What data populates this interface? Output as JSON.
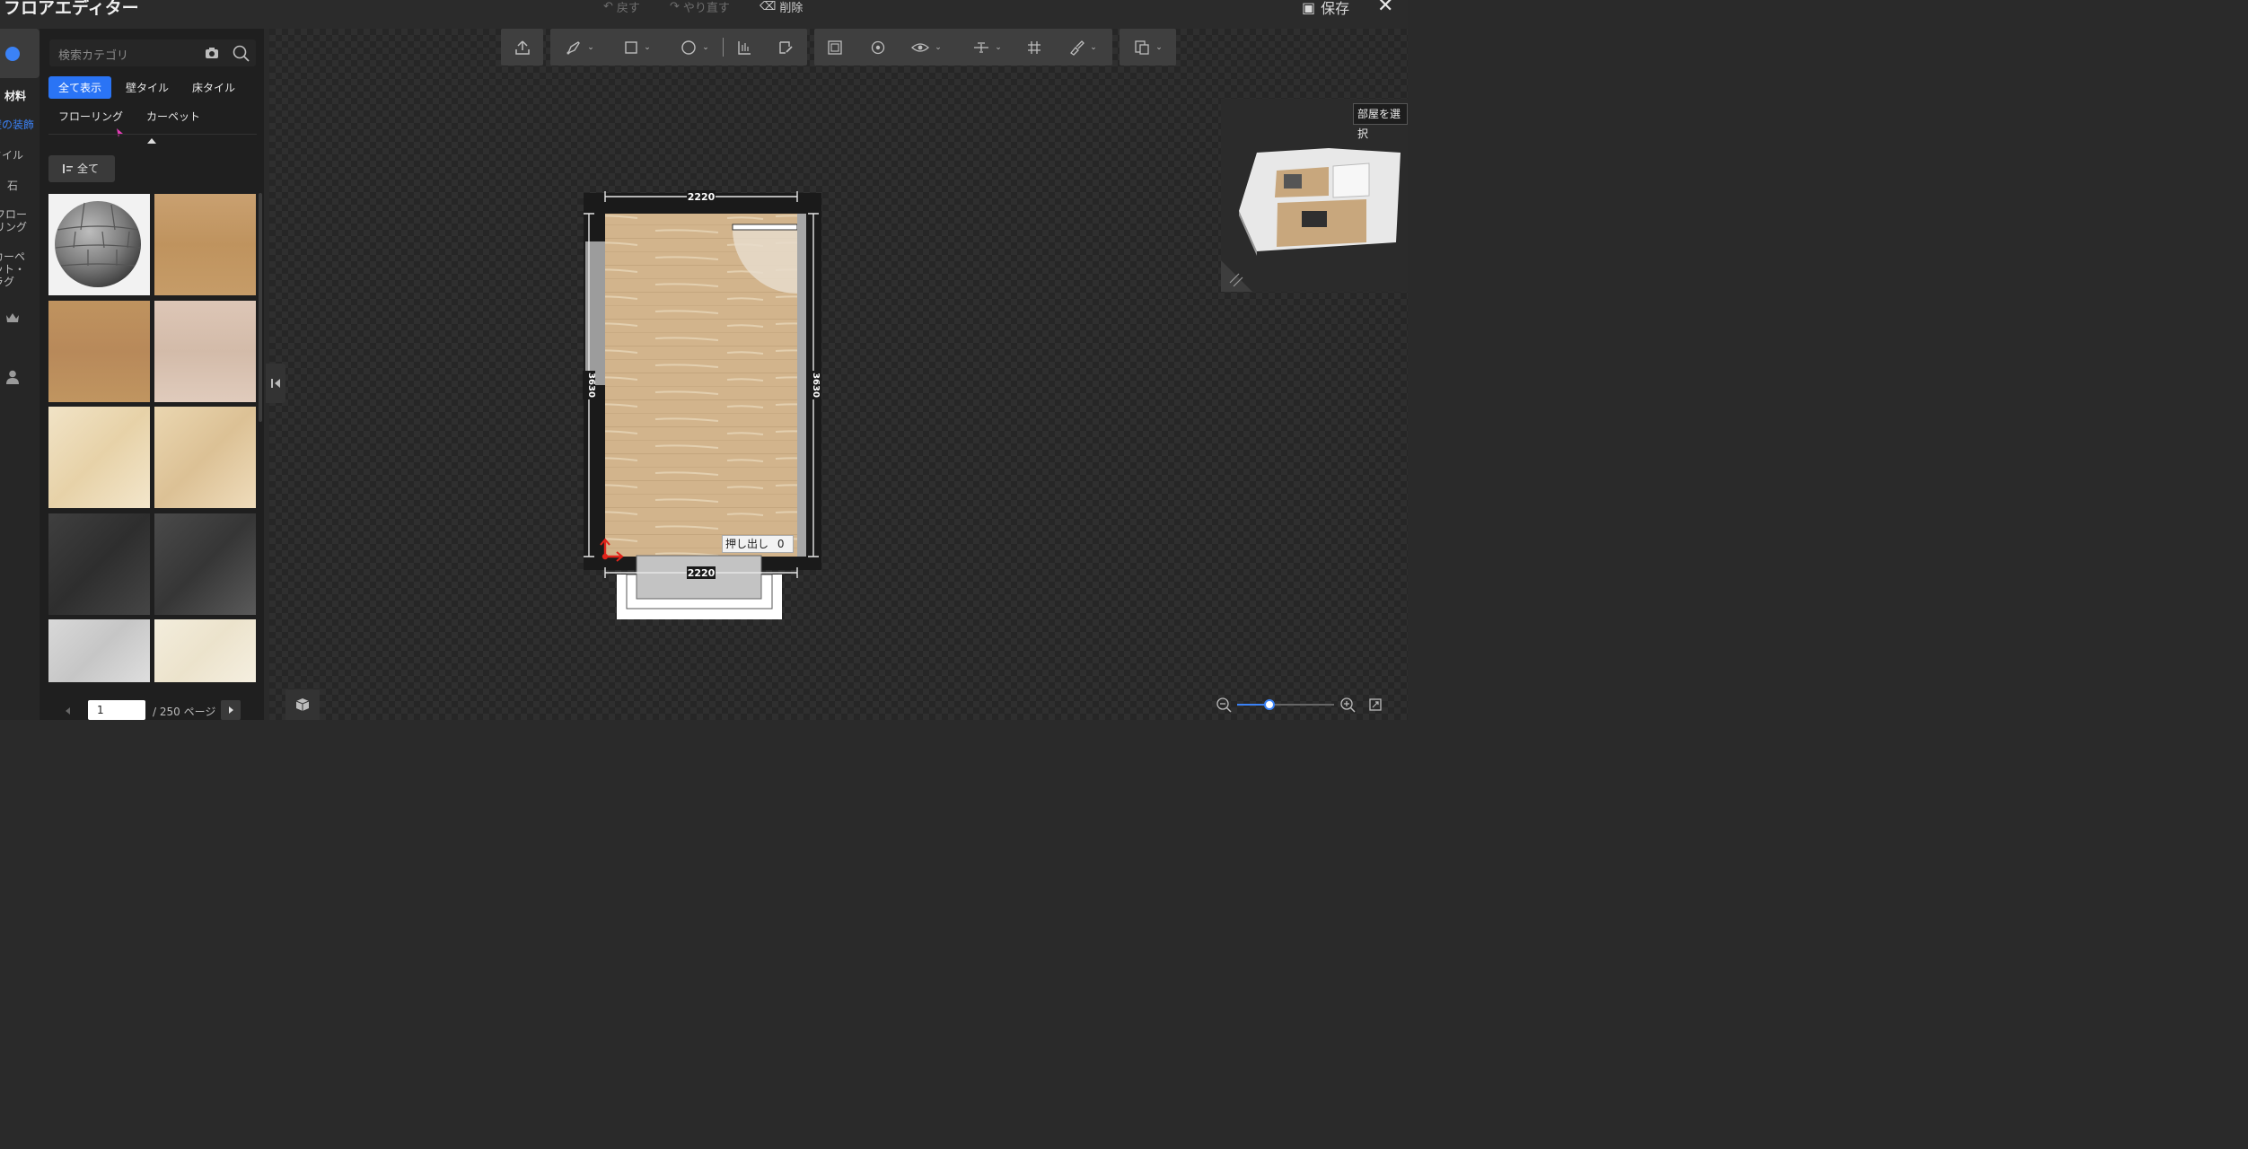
{
  "app": {
    "title": "フロアエディター"
  },
  "topbar": {
    "undo": "戻す",
    "redo": "やり直す",
    "delete": "削除",
    "save": "保存",
    "close": "✕"
  },
  "rail": {
    "items": [
      {
        "label": "材料",
        "icon": "material-icon"
      },
      {
        "label": "壁の装飾"
      },
      {
        "label": "タイル"
      },
      {
        "label": "石"
      },
      {
        "label": "フローリング"
      },
      {
        "label": "カーペット・ラグ"
      }
    ],
    "crown_icon": "crown-icon",
    "user_icon": "user-icon"
  },
  "panel": {
    "search_placeholder": "検索カテゴリ",
    "chips": [
      "全て表示",
      "壁タイル",
      "床タイル",
      "フローリング",
      "カーペット"
    ],
    "sort_label": "全て",
    "page_current": "1",
    "page_total": "/ 250 ページ"
  },
  "canvas": {
    "dim_top": "2220",
    "dim_bottom": "2220",
    "dim_left": "3630",
    "dim_right": "3630",
    "extrude_label": "押し出し",
    "extrude_value": "0",
    "minimap_label": "部屋を選択"
  },
  "colors": {
    "accent": "#2a74f5",
    "floor": "#d2b48c",
    "selection": "#e2231a"
  }
}
